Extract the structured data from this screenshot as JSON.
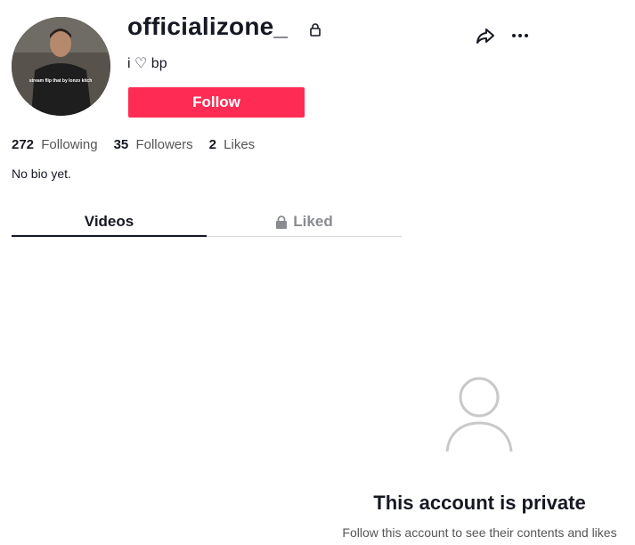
{
  "profile": {
    "username": "officializone_",
    "nickname": "i ♡ bp",
    "follow_label": "Follow",
    "avatar_caption": "stream flip that by lonzo kitch",
    "bio": "No bio yet."
  },
  "stats": [
    {
      "value": "272",
      "label": "Following"
    },
    {
      "value": "35",
      "label": "Followers"
    },
    {
      "value": "2",
      "label": "Likes"
    }
  ],
  "tabs": {
    "videos": "Videos",
    "liked": "Liked"
  },
  "private": {
    "title": "This account is private",
    "subtitle": "Follow this account to see their contents and likes"
  },
  "colors": {
    "accent": "#fe2c55",
    "text": "#161823",
    "muted": "#8a8b91"
  },
  "icons": [
    "lock-icon",
    "share-icon",
    "more-icon",
    "user-icon"
  ]
}
